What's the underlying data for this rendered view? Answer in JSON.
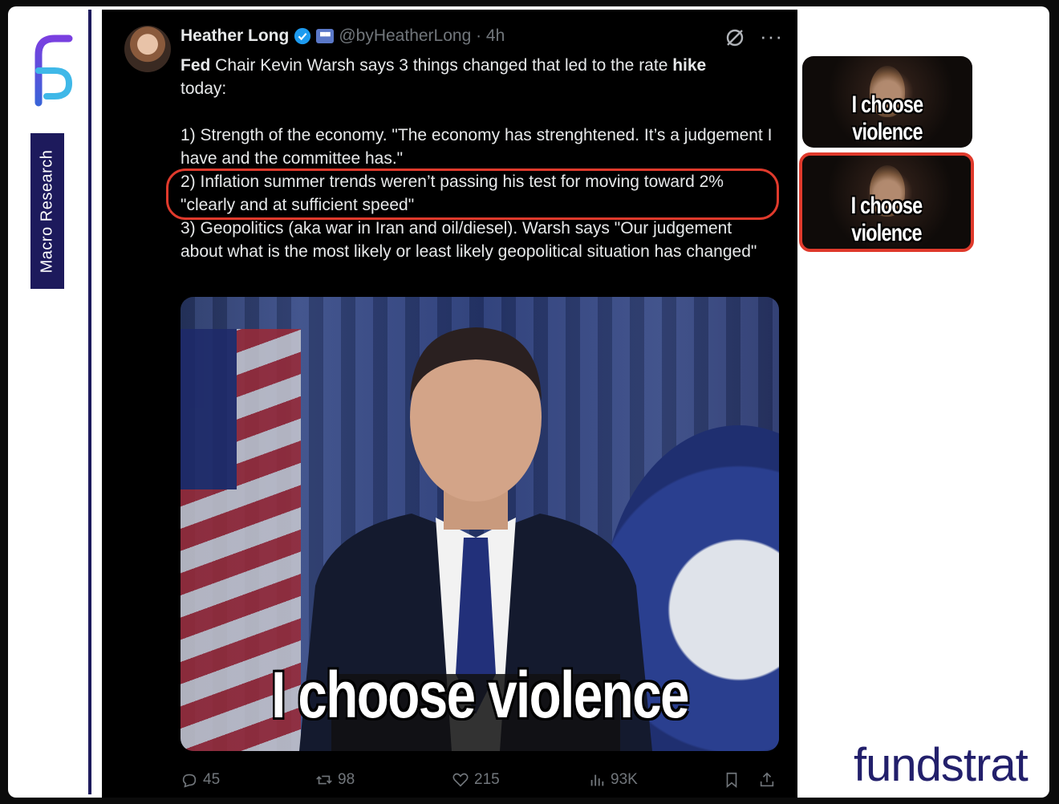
{
  "sidebar": {
    "tab_label": "Macro Research"
  },
  "tweet": {
    "author_name": "Heather Long",
    "handle": "@byHeatherLong · 4h",
    "text_line1_bold": "Fed",
    "text_line1": " Chair Kevin Warsh says 3 things changed that led to the rate ",
    "text_line1_bold2": "hike",
    "text_line1_end": "today:",
    "point1": "1) Strength of the economy. \"The economy has strenghtened. It’s a judgement I have and the committee has.\"",
    "point2": "2) Inflation summer trends weren’t passing his test for moving toward 2% \"clearly and at sufficient speed\"",
    "point3": "3) Geopolitics (aka war in Iran and oil/diesel). Warsh says \"Our judgement about what is the most likely or least likely geopolitical situation has changed\"",
    "media_caption": "I choose violence",
    "stats": {
      "replies": "45",
      "reposts": "98",
      "likes": "215",
      "views": "93K"
    }
  },
  "thumbnails": [
    {
      "caption": "I choose violence"
    },
    {
      "caption": "I choose violence"
    }
  ],
  "brand": {
    "wordmark": "fundstrat",
    "accent_color": "#221f6b",
    "highlight_color": "#e03a2c"
  }
}
